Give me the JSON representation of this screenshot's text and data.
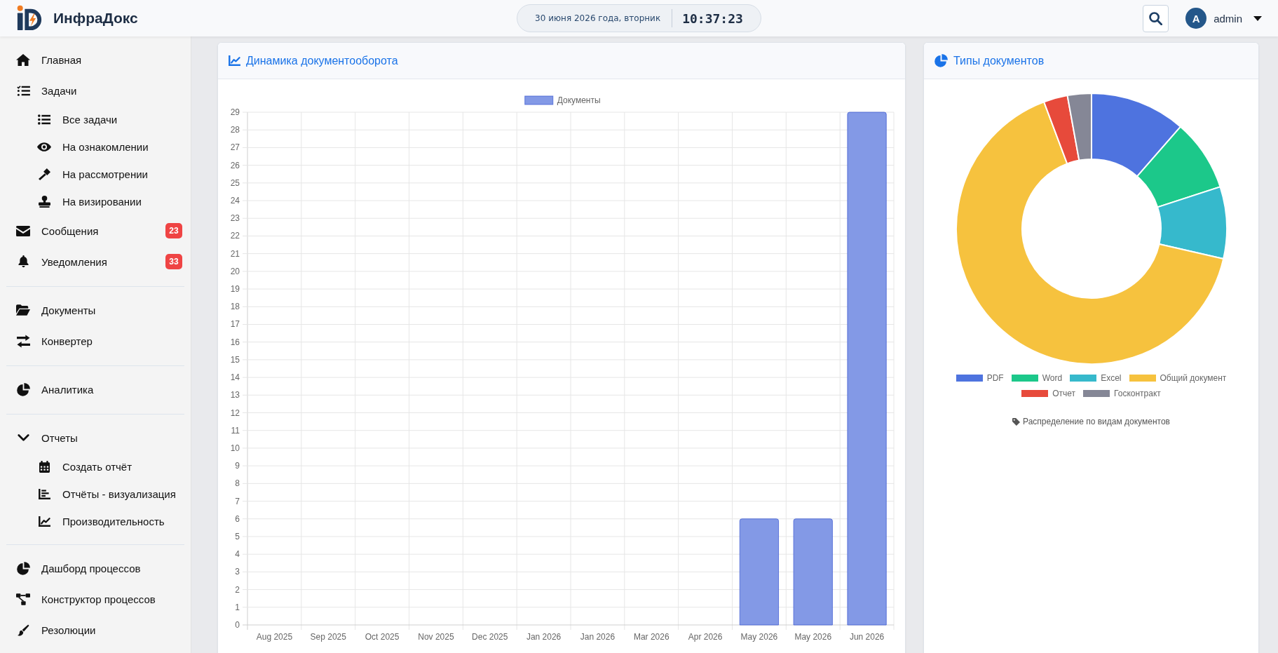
{
  "header": {
    "brand": "ИнфраДокс",
    "date": "30 июня 2026 года, вторник",
    "time": "10:37:23",
    "user": {
      "initial": "A",
      "name": "admin"
    }
  },
  "sidebar": {
    "sections": [
      {
        "items": [
          {
            "label": "Главная"
          },
          {
            "label": "Задачи",
            "children": [
              {
                "label": "Все задачи"
              },
              {
                "label": "На ознакомлении"
              },
              {
                "label": "На рассмотрении"
              },
              {
                "label": "На визировании"
              }
            ]
          },
          {
            "label": "Сообщения",
            "badge": "23"
          },
          {
            "label": "Уведомления",
            "badge": "33"
          }
        ]
      },
      {
        "items": [
          {
            "label": "Документы"
          },
          {
            "label": "Конвертер"
          }
        ]
      },
      {
        "items": [
          {
            "label": "Аналитика"
          }
        ]
      },
      {
        "items": [
          {
            "label": "Отчеты",
            "expanded": true,
            "children": [
              {
                "label": "Создать отчёт"
              },
              {
                "label": "Отчёты - визуализация"
              },
              {
                "label": "Производительность"
              }
            ]
          }
        ]
      },
      {
        "items": [
          {
            "label": "Дашборд процессов"
          },
          {
            "label": "Конструктор процессов"
          },
          {
            "label": "Резолюции"
          }
        ]
      }
    ]
  },
  "cards": [
    {
      "title": "Динамика документооборота",
      "chart_data": {
        "type": "bar",
        "categories": [
          "Aug 2025",
          "Sep 2025",
          "Oct 2025",
          "Nov 2025",
          "Dec 2025",
          "Jan 2026",
          "Jan 2026",
          "Mar 2026",
          "Apr 2026",
          "May 2026",
          "May 2026",
          "Jun 2026"
        ],
        "series": [
          {
            "name": "Документы",
            "color": "#8399e6",
            "values": [
              0,
              0,
              0,
              0,
              0,
              0,
              0,
              0,
              0,
              6,
              6,
              29
            ]
          }
        ],
        "ylim": [
          0,
          29
        ],
        "yticks": [
          0,
          1,
          2,
          3,
          4,
          5,
          6,
          7,
          8,
          9,
          10,
          11,
          12,
          13,
          14,
          15,
          16,
          17,
          18,
          19,
          20,
          21,
          22,
          23,
          24,
          25,
          26,
          27,
          28,
          29
        ],
        "grid": true
      }
    },
    {
      "title": "Типы документов",
      "legend": [
        {
          "label": "PDF",
          "color": "#4e73df"
        },
        {
          "label": "Word",
          "color": "#1cc88a"
        },
        {
          "label": "Excel",
          "color": "#36b9cc"
        },
        {
          "label": "Общий документ",
          "color": "#f6c23e"
        },
        {
          "label": "Отчет",
          "color": "#e74a3b"
        },
        {
          "label": "Госконтракт",
          "color": "#858796"
        }
      ],
      "caption": "Распределение по видам документов"
    }
  ]
}
